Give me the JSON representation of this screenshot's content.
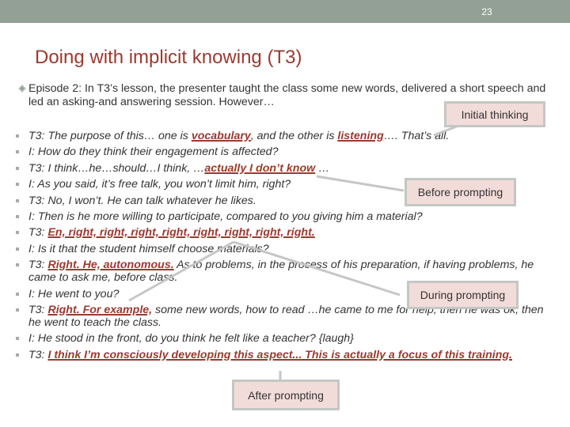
{
  "slide": {
    "number": "23",
    "title": "Doing with implicit knowing (T3)",
    "intro": "Episode 2: In T3’s lesson, the presenter taught the class some new words, delivered a short speech and led an asking-and answering session. However…",
    "colors": {
      "header_bar": "#92a095",
      "accent": "#9a3a2f",
      "callout_fill": "#f2dcd9",
      "callout_border": "#c4c7c4"
    }
  },
  "dialogue": [
    {
      "segments": [
        {
          "t": "T3:  The purpose of this… one is "
        },
        {
          "t": "vocabulary",
          "hl": true
        },
        {
          "t": ", and the other is "
        },
        {
          "t": "listening",
          "hl": true
        },
        {
          "t": "…. That’s all."
        }
      ]
    },
    {
      "segments": [
        {
          "t": "I:     How do they think their engagement is affected?"
        }
      ]
    },
    {
      "segments": [
        {
          "t": "T3:  I think…he…should…I think, …"
        },
        {
          "t": "actually I don’t know",
          "hl": true
        },
        {
          "t": " …"
        }
      ]
    },
    {
      "segments": [
        {
          "t": "I:     As you said, it’s free talk, you won’t limit him, right?"
        }
      ]
    },
    {
      "segments": [
        {
          "t": "T3: No, I won’t. He can talk whatever he likes."
        }
      ]
    },
    {
      "segments": [
        {
          "t": "I:    Then is he more willing to participate, compared to you giving him a material?"
        }
      ]
    },
    {
      "segments": [
        {
          "t": "T3: "
        },
        {
          "t": "En, right, right, right, right, right, right, right, right.",
          "hl": true
        }
      ]
    },
    {
      "segments": [
        {
          "t": "I:    Is it that the student himself choose materials?"
        }
      ]
    },
    {
      "segments": [
        {
          "t": "T3: "
        },
        {
          "t": "Right. He, autonomous.",
          "hl": true
        },
        {
          "t": " As to problems, in the process of his preparation, if having problems, he came to ask me, before class."
        }
      ]
    },
    {
      "segments": [
        {
          "t": "I:   He went to you?"
        }
      ]
    },
    {
      "segments": [
        {
          "t": "T3: "
        },
        {
          "t": "Right. For example,",
          "hl": true
        },
        {
          "t": " some new words, how to read …he came to me for help, then he was ok, then he went to teach the class."
        }
      ]
    },
    {
      "segments": [
        {
          "t": "I:   He stood in the front, do you think he felt like a teacher? {laugh}"
        }
      ]
    },
    {
      "segments": [
        {
          "t": "T3: "
        },
        {
          "t": "I think I’m consciously developing this aspect... This is actually a focus of this training.",
          "hl": true
        }
      ]
    }
  ],
  "callouts": {
    "initial": "Initial thinking",
    "before": "Before prompting",
    "during": "During prompting",
    "after": "After prompting"
  }
}
